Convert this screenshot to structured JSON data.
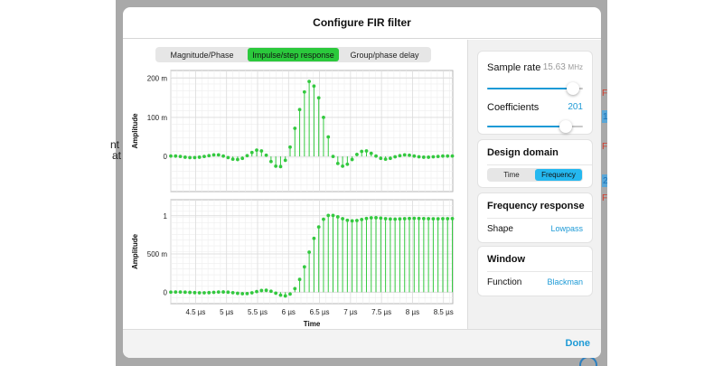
{
  "dialog": {
    "title": "Configure FIR filter",
    "done_label": "Done"
  },
  "background": {
    "fragment_1": "nt",
    "fragment_2": "at",
    "marker_1": "F",
    "marker_2": "F",
    "marker_3": "F",
    "marker_4": "1",
    "marker_5": "2"
  },
  "plot_tabs": [
    {
      "label": "Magnitude/Phase",
      "selected": false
    },
    {
      "label": "Impulse/step response",
      "selected": true
    },
    {
      "label": "Group/phase delay",
      "selected": false
    }
  ],
  "chart_data": [
    {
      "type": "stem",
      "name": "impulse-response",
      "ylabel": "Amplitude",
      "ylim": [
        -0.09,
        0.22
      ],
      "yticks": [
        {
          "value": 0.2,
          "label": "200 m"
        },
        {
          "value": 0.1,
          "label": "100 m"
        },
        {
          "value": 0,
          "label": "0"
        }
      ],
      "xlim": [
        4.1,
        8.65
      ],
      "grid": true,
      "color": "#33c93f",
      "x": [
        4.1,
        4.177,
        4.254,
        4.331,
        4.408,
        4.485,
        4.562,
        4.639,
        4.716,
        4.793,
        4.87,
        4.947,
        5.024,
        5.101,
        5.178,
        5.255,
        5.332,
        5.409,
        5.486,
        5.563,
        5.64,
        5.717,
        5.794,
        5.871,
        5.948,
        6.025,
        6.102,
        6.179,
        6.256,
        6.333,
        6.41,
        6.487,
        6.564,
        6.641,
        6.718,
        6.795,
        6.872,
        6.949,
        7.026,
        7.103,
        7.18,
        7.257,
        7.334,
        7.411,
        7.488,
        7.565,
        7.642,
        7.719,
        7.796,
        7.873,
        7.95,
        8.027,
        8.104,
        8.181,
        8.258,
        8.335,
        8.412,
        8.489,
        8.566,
        8.643
      ],
      "y": [
        0.001,
        0.001,
        0.0,
        -0.002,
        -0.003,
        -0.003,
        -0.002,
        0.0,
        0.002,
        0.004,
        0.004,
        0.001,
        -0.003,
        -0.007,
        -0.008,
        -0.005,
        0.002,
        0.01,
        0.016,
        0.014,
        0.003,
        -0.013,
        -0.025,
        -0.026,
        -0.01,
        0.024,
        0.072,
        0.12,
        0.165,
        0.192,
        0.18,
        0.15,
        0.1,
        0.05,
        0.0,
        -0.018,
        -0.025,
        -0.02,
        -0.008,
        0.005,
        0.013,
        0.014,
        0.008,
        0.001,
        -0.005,
        -0.007,
        -0.005,
        -0.001,
        0.002,
        0.004,
        0.003,
        0.001,
        -0.001,
        -0.002,
        -0.002,
        -0.001,
        0.0,
        0.001,
        0.001,
        0.001
      ]
    },
    {
      "type": "stem",
      "name": "step-response",
      "ylabel": "Amplitude",
      "xlabel": "Time",
      "ylim": [
        -0.15,
        1.21
      ],
      "yticks": [
        {
          "value": 1,
          "label": "1"
        },
        {
          "value": 0.5,
          "label": "500 m"
        },
        {
          "value": 0,
          "label": "0"
        }
      ],
      "xlim": [
        4.1,
        8.65
      ],
      "xticks": [
        {
          "value": 4.5,
          "label": "4.5 µs"
        },
        {
          "value": 5,
          "label": "5 µs"
        },
        {
          "value": 5.5,
          "label": "5.5 µs"
        },
        {
          "value": 6,
          "label": "6 µs"
        },
        {
          "value": 6.5,
          "label": "6.5 µs"
        },
        {
          "value": 7,
          "label": "7 µs"
        },
        {
          "value": 7.5,
          "label": "7.5 µs"
        },
        {
          "value": 8,
          "label": "8 µs"
        },
        {
          "value": 8.5,
          "label": "8.5 µs"
        }
      ],
      "grid": true,
      "color": "#33c93f",
      "x": [
        4.1,
        4.177,
        4.254,
        4.331,
        4.408,
        4.485,
        4.562,
        4.639,
        4.716,
        4.793,
        4.87,
        4.947,
        5.024,
        5.101,
        5.178,
        5.255,
        5.332,
        5.409,
        5.486,
        5.563,
        5.64,
        5.717,
        5.794,
        5.871,
        5.948,
        6.025,
        6.102,
        6.179,
        6.256,
        6.333,
        6.41,
        6.487,
        6.564,
        6.641,
        6.718,
        6.795,
        6.872,
        6.949,
        7.026,
        7.103,
        7.18,
        7.257,
        7.334,
        7.411,
        7.488,
        7.565,
        7.642,
        7.719,
        7.796,
        7.873,
        7.95,
        8.027,
        8.104,
        8.181,
        8.258,
        8.335,
        8.412,
        8.489,
        8.566,
        8.643
      ],
      "y": [
        0.001,
        0.002,
        0.002,
        0.0,
        -0.003,
        -0.006,
        -0.008,
        -0.008,
        -0.006,
        -0.002,
        0.002,
        0.003,
        0.0,
        -0.007,
        -0.015,
        -0.02,
        -0.018,
        -0.008,
        0.008,
        0.022,
        0.025,
        0.012,
        -0.013,
        -0.039,
        -0.049,
        -0.025,
        0.047,
        0.167,
        0.332,
        0.524,
        0.704,
        0.854,
        0.954,
        1.004,
        1.004,
        0.986,
        0.961,
        0.941,
        0.933,
        0.938,
        0.951,
        0.965,
        0.973,
        0.974,
        0.969,
        0.962,
        0.957,
        0.956,
        0.958,
        0.962,
        0.965,
        0.966,
        0.965,
        0.963,
        0.961,
        0.96,
        0.96,
        0.961,
        0.962,
        0.963
      ]
    }
  ],
  "settings": {
    "sample_rate": {
      "label": "Sample rate",
      "value": "15.63",
      "unit": "MHz",
      "slider_fraction": 0.9
    },
    "coefficients": {
      "label": "Coefficients",
      "value": "201",
      "slider_fraction": 0.82
    },
    "design_domain": {
      "title": "Design domain",
      "options": [
        "Time",
        "Frequency"
      ],
      "selected": "Frequency"
    },
    "frequency_response": {
      "title": "Frequency response",
      "shape_label": "Shape",
      "shape_value": "Lowpass"
    },
    "window": {
      "title": "Window",
      "function_label": "Function",
      "function_value": "Blackman"
    }
  },
  "colors": {
    "accent_blue": "#1d9ad6",
    "stem_green": "#33c93f",
    "tab_active_green": "#2bc93c",
    "segment_active_blue": "#25b8ef"
  }
}
